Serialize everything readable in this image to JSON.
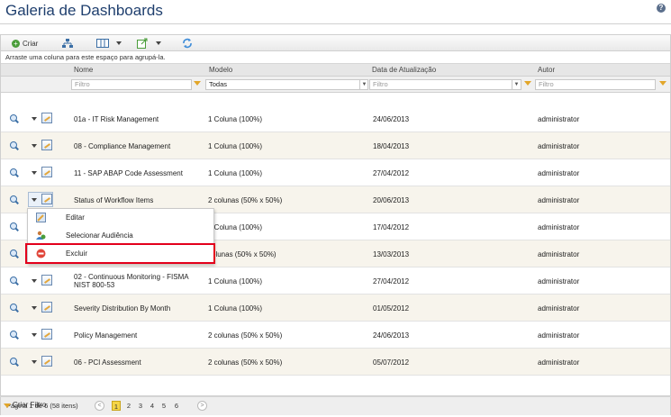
{
  "page": {
    "title": "Galeria de Dashboards",
    "help_icon": "?"
  },
  "toolbar": {
    "create_label": "Criar"
  },
  "group_hint": "Arraste uma coluna para este espaço para agrupá-la.",
  "columns": {
    "name": "Nome",
    "model": "Modelo",
    "updated": "Data de Atualização",
    "author": "Autor"
  },
  "filters": {
    "name_placeholder": "Filtro",
    "model_value": "Todas",
    "date_placeholder": "Filtro",
    "author_placeholder": "Filtro"
  },
  "rows": [
    {
      "name": "01a - IT Risk Management",
      "model": "1 Coluna (100%)",
      "updated": "24/06/2013",
      "author": "administrator"
    },
    {
      "name": "08 - Compliance Management",
      "model": "1 Coluna (100%)",
      "updated": "18/04/2013",
      "author": "administrator"
    },
    {
      "name": "11 - SAP ABAP Code Assessment",
      "model": "1 Coluna (100%)",
      "updated": "27/04/2012",
      "author": "administrator"
    },
    {
      "name": "Status of Workflow Items",
      "model": "2 colunas (50% x 50%)",
      "updated": "20/06/2013",
      "author": "administrator"
    },
    {
      "name": "",
      "model": "1 Coluna (100%)",
      "updated": "17/04/2012",
      "author": "administrator"
    },
    {
      "name": "",
      "model": "colunas (50% x 50%)",
      "updated": "13/03/2013",
      "author": "administrator"
    },
    {
      "name": "02 - Continuous Monitoring - FISMA NIST 800-53",
      "model": "1 Coluna (100%)",
      "updated": "27/04/2012",
      "author": "administrator"
    },
    {
      "name": "Severity Distribution By Month",
      "model": "1 Coluna (100%)",
      "updated": "01/05/2012",
      "author": "administrator"
    },
    {
      "name": "Policy Management",
      "model": "2 colunas (50% x 50%)",
      "updated": "24/06/2013",
      "author": "administrator"
    },
    {
      "name": "06 - PCI Assessment",
      "model": "2 colunas (50% x 50%)",
      "updated": "05/07/2012",
      "author": "administrator"
    }
  ],
  "context_menu": {
    "edit": "Editar",
    "audience": "Selecionar Audiência",
    "delete": "Excluir"
  },
  "pager": {
    "summary": "Página 1 de 6 (58 itens)",
    "pages": [
      "1",
      "2",
      "3",
      "4",
      "5",
      "6"
    ],
    "prev": "<",
    "next": ">"
  },
  "footer": {
    "create_filter": "Criar Filtro"
  }
}
